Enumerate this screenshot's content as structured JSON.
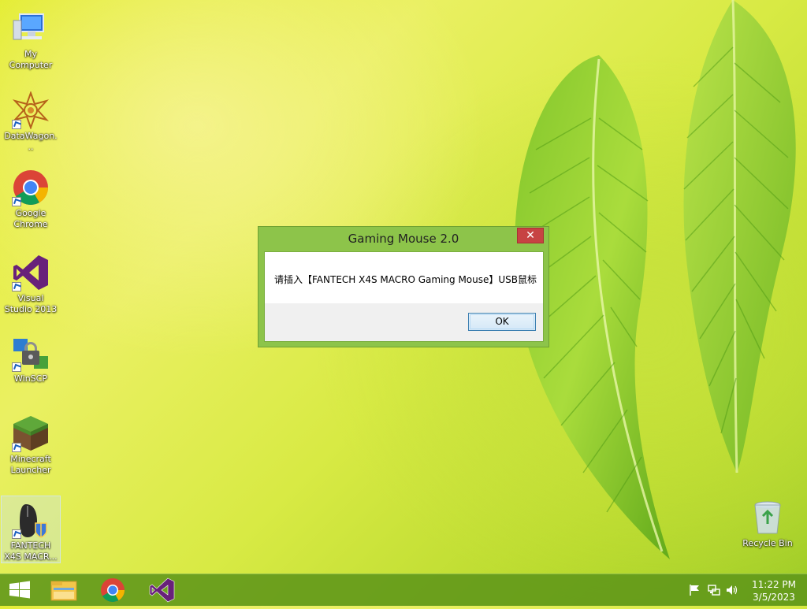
{
  "desktop": {
    "icons": [
      {
        "label": "My Computer",
        "icon": "computer-icon"
      },
      {
        "label": "DataWagon...",
        "icon": "datawagon-icon"
      },
      {
        "label": "Google Chrome",
        "icon": "chrome-icon"
      },
      {
        "label": "Visual Studio 2013",
        "icon": "visual-studio-icon"
      },
      {
        "label": "WinSCP",
        "icon": "winscp-icon"
      },
      {
        "label": "Minecraft Launcher",
        "icon": "minecraft-icon"
      },
      {
        "label": "FANTECH X4S MACR...",
        "icon": "fantech-mouse-icon"
      }
    ],
    "recycle_bin": {
      "label": "Recycle Bin",
      "icon": "recycle-bin-icon"
    }
  },
  "dialog": {
    "title": "Gaming Mouse 2.0",
    "close": "✕",
    "message": "请插入【FANTECH X4S MACRO Gaming Mouse】USB鼠标",
    "ok_label": "OK"
  },
  "taskbar": {
    "start_icon": "windows-start-icon",
    "pinned": [
      "file-explorer-icon",
      "chrome-icon",
      "visual-studio-icon"
    ],
    "tray_icons": [
      "flag-icon",
      "network-icon",
      "volume-icon"
    ],
    "time": "11:22 PM",
    "date": "3/5/2023"
  },
  "colors": {
    "accent": "#8dc44a",
    "close": "#c74343",
    "taskbar": "#5f9619"
  }
}
